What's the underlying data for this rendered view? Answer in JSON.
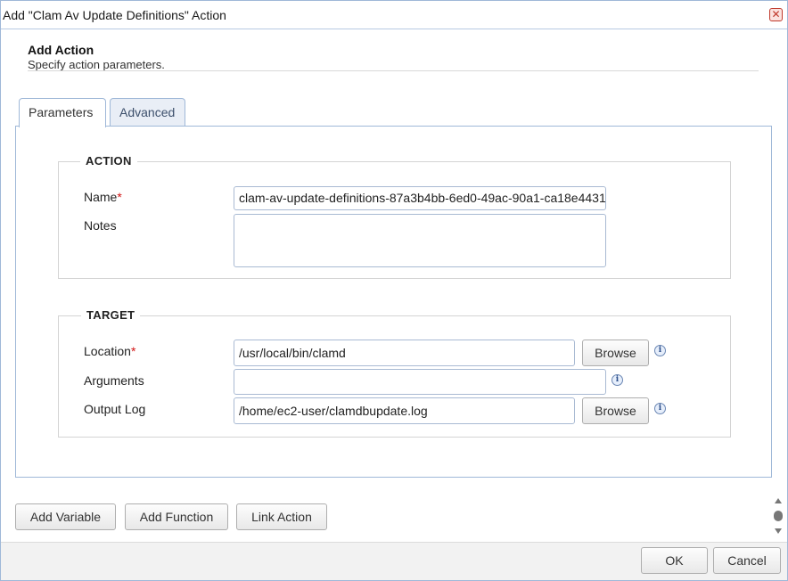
{
  "dialog": {
    "title": "Add \"Clam Av Update Definitions\" Action",
    "close_glyph": "✕"
  },
  "header": {
    "title": "Add Action",
    "subtitle": "Specify action parameters."
  },
  "tabs": [
    {
      "label": "Parameters",
      "active": true
    },
    {
      "label": "Advanced",
      "active": false
    }
  ],
  "action_section": {
    "legend": "ACTION",
    "name_label": "Name",
    "name_value": "clam-av-update-definitions-87a3b4bb-6ed0-49ac-90a1-ca18e4431",
    "notes_label": "Notes",
    "notes_value": ""
  },
  "target_section": {
    "legend": "TARGET",
    "location_label": "Location",
    "location_value": "/usr/local/bin/clamd",
    "arguments_label": "Arguments",
    "arguments_value": "",
    "output_log_label": "Output Log",
    "output_log_value": "/home/ec2-user/clamdbupdate.log",
    "browse_label": "Browse"
  },
  "required_marker": "*",
  "info_glyph": "i",
  "actions": {
    "add_variable": "Add Variable",
    "add_function": "Add Function",
    "link_action": "Link Action"
  },
  "footer": {
    "ok": "OK",
    "cancel": "Cancel"
  },
  "colors": {
    "border_accent": "#9fb8d8",
    "required": "#d21414"
  }
}
